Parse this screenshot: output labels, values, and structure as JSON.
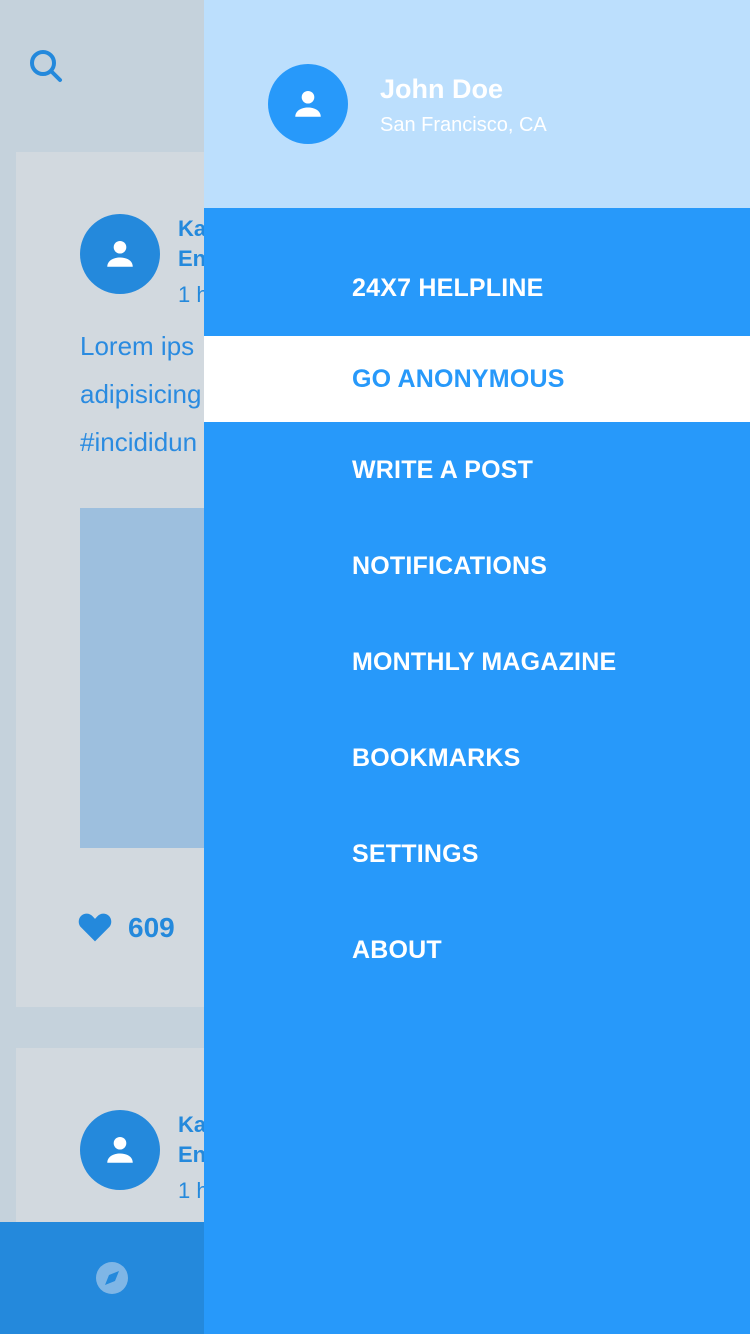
{
  "colors": {
    "accent": "#2799FA",
    "feed_blue": "#2489DC",
    "drawer_header_bg": "#BCDFFD",
    "active_item_bg": "#FFFFFF",
    "feed_bg": "#C5D2DC"
  },
  "feed": {
    "search_icon": "search-icon",
    "posts": [
      {
        "author_line1": "Ka",
        "author_line2": "En",
        "time": "1 h",
        "text_lines": [
          "Lorem ips",
          "adipisicing",
          "#incididun"
        ],
        "likes": "609"
      },
      {
        "author_line1": "Ka",
        "author_line2": "En",
        "time": "1 h"
      }
    ],
    "bottom_nav_icon": "compass-icon"
  },
  "drawer": {
    "user": {
      "name": "John Doe",
      "location": "San Francisco, CA"
    },
    "menu": [
      {
        "label": "24X7 HELPLINE",
        "active": false
      },
      {
        "label": "GO ANONYMOUS",
        "active": true
      },
      {
        "label": "WRITE A POST",
        "active": false
      },
      {
        "label": "NOTIFICATIONS",
        "active": false
      },
      {
        "label": "MONTHLY MAGAZINE",
        "active": false
      },
      {
        "label": "BOOKMARKS",
        "active": false
      },
      {
        "label": "SETTINGS",
        "active": false
      },
      {
        "label": "ABOUT",
        "active": false
      }
    ]
  }
}
